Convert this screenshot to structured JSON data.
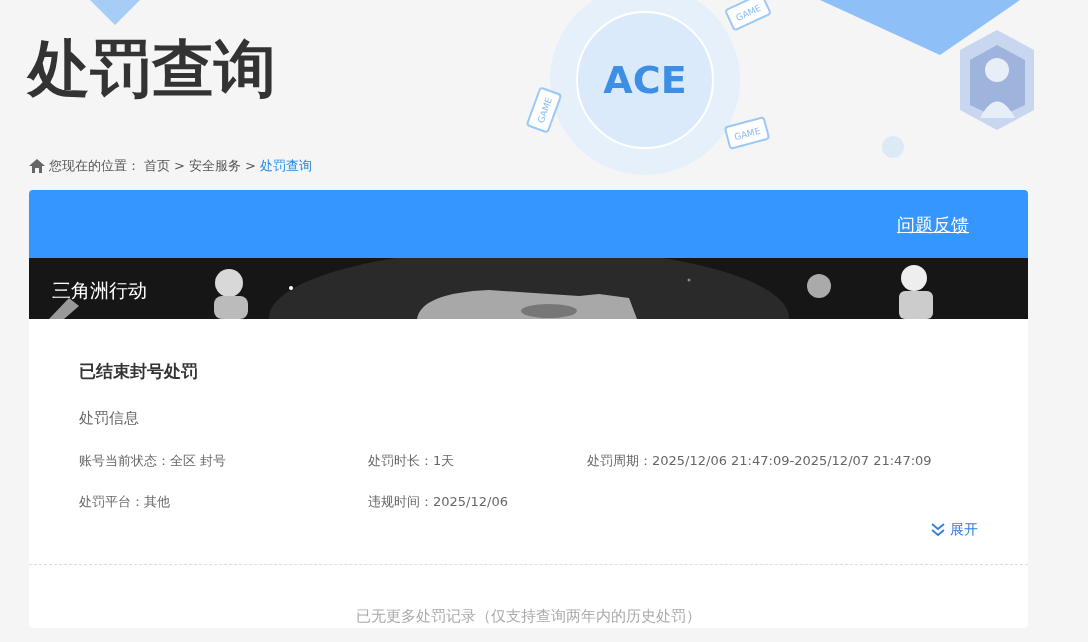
{
  "page_title": "处罚查询",
  "header_art": {
    "logo_text": "ACE",
    "badges": [
      "GAME",
      "GAME",
      "GAME"
    ]
  },
  "breadcrumb": {
    "prefix": "您现在的位置：",
    "items": [
      {
        "label": "首页",
        "current": false
      },
      {
        "label": "安全服务",
        "current": false
      },
      {
        "label": "处罚查询",
        "current": true
      }
    ],
    "separator": ">"
  },
  "feedback_link": "问题反馈",
  "game_banner": {
    "title": "三角洲行动"
  },
  "record": {
    "title": "已结束封号处罚",
    "section": "处罚信息",
    "fields": [
      {
        "label": "账号当前状态：",
        "value": "全区 封号"
      },
      {
        "label": "处罚时长：",
        "value": "1天"
      },
      {
        "label": "处罚周期：",
        "value": "2025/12/06 21:47:09-2025/12/07 21:47:09"
      },
      {
        "label": "处罚平台：",
        "value": "其他"
      },
      {
        "label": "违规时间：",
        "value": "2025/12/06"
      }
    ],
    "expand": {
      "label": "展开",
      "expanded": false
    }
  },
  "footer_note": "已无更多处罚记录（仅支持查询两年内的历史处罚）"
}
